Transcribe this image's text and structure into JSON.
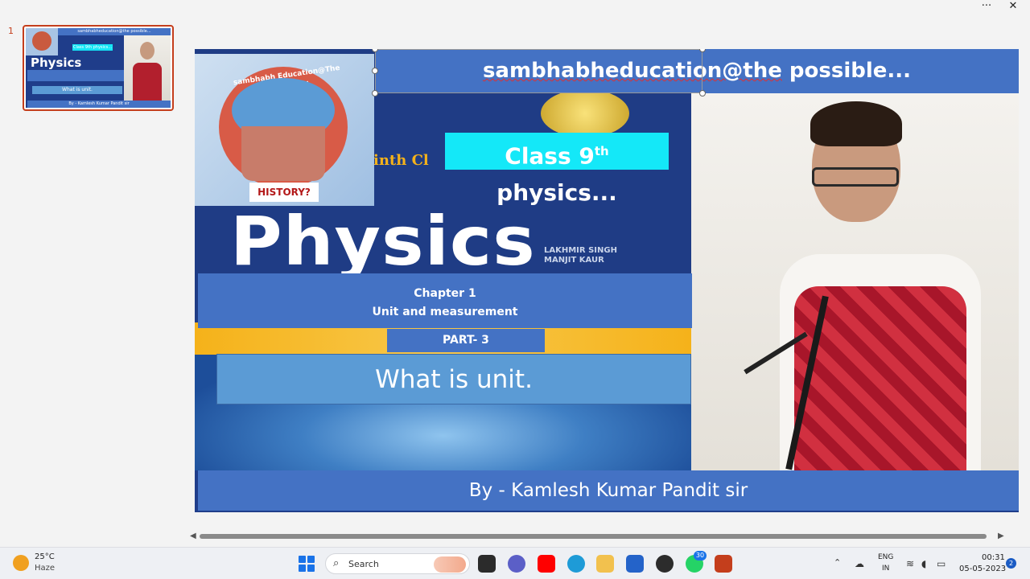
{
  "window": {
    "more_label": "···",
    "close_label": "✕"
  },
  "thumbnails": {
    "slide_number": "1",
    "thumb_header": "sambhabheducation@the possible...",
    "thumb_class": "Class 9th physics...",
    "thumb_physics": "Physics",
    "thumb_unit": "What is unit.",
    "thumb_footer": "By - Kamlesh Kumar Pandit sir"
  },
  "slide": {
    "title_underlined": "sambhabheducation@the",
    "title_rest": " possible...",
    "class_main": "Class 9",
    "class_sup": "th",
    "class_rest": " physics...",
    "book_title": "Physics",
    "book_ninth": "inth Cl",
    "book_authors_1": "LAKHMIR SINGH",
    "book_authors_2": "MANJIT KAUR",
    "logo_ring_text": "sambhabh Education@The possible...",
    "logo_history": "HISTORY?",
    "chapter_line1": "Chapter 1",
    "chapter_line2": "Unit and measurement",
    "part_label": "PART- 3",
    "unit_question": "What is unit.",
    "footer_author": "By - Kamlesh Kumar Pandit sir"
  },
  "taskbar": {
    "weather_temp": "25°C",
    "weather_condition": "Haze",
    "search_placeholder": "Search",
    "whatsapp_badge": "30",
    "language_line1": "ENG",
    "language_line2": "IN",
    "clock_time": "00:31",
    "clock_date": "05-05-2023",
    "notification_count": "2",
    "colors": {
      "accent": "#c43e1c",
      "slide_blue": "#4472c4",
      "cyan": "#14e8f8"
    }
  }
}
